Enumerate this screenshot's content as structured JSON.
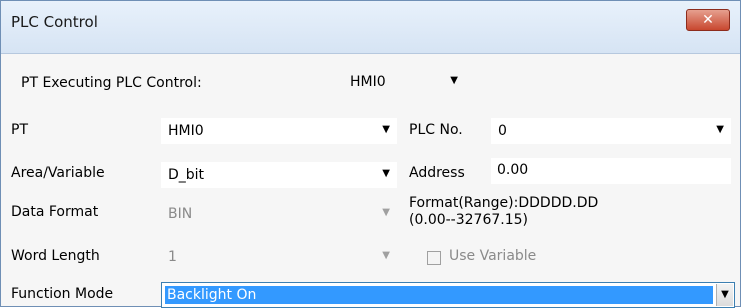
{
  "window": {
    "title": "PLC Control",
    "close_glyph": "✕"
  },
  "form": {
    "pt_executing_label": "PT Executing PLC Control:",
    "pt_executing_value": "HMI0",
    "pt_label": "PT",
    "pt_value": "HMI0",
    "plc_no_label": "PLC No.",
    "plc_no_value": "0",
    "area_label": "Area/Variable",
    "area_value": "D_bit",
    "address_label": "Address",
    "address_value": "0.00",
    "data_format_label": "Data Format",
    "data_format_value": "BIN",
    "format_line1": "Format(Range):DDDDD.DD",
    "format_line2": "(0.00--32767.15)",
    "word_length_label": "Word Length",
    "word_length_value": "1",
    "use_variable_label": "Use Variable",
    "function_mode_label": "Function Mode",
    "function_mode_value": "Backlight On"
  },
  "icons": {
    "dropdown_arrow": "▼"
  }
}
